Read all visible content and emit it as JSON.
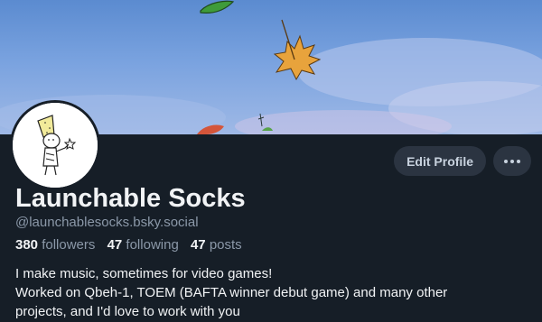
{
  "profile": {
    "display_name": "Launchable Socks",
    "handle": "@launchablesocks.bsky.social",
    "stats": {
      "followers_count": "380",
      "followers_label": "followers",
      "following_count": "47",
      "following_label": "following",
      "posts_count": "47",
      "posts_label": "posts"
    },
    "bio": {
      "line1": "I make music, sometimes for video games!",
      "line2": "Worked on Qbeh-1, TOEM (BAFTA winner debut game) and many other",
      "line3": "projects, and I'd love to work with you"
    }
  },
  "actions": {
    "edit_profile_label": "Edit Profile",
    "more_icon": "ellipsis-icon"
  },
  "banner": {
    "description_icon": "autumn-leaves-sky-image"
  },
  "avatar": {
    "icon": "wizard-drawing-avatar"
  },
  "colors": {
    "background": "#161e27",
    "button_bg": "#2b3441",
    "text_primary": "#f1f3f5",
    "text_secondary": "#8b98a8"
  }
}
